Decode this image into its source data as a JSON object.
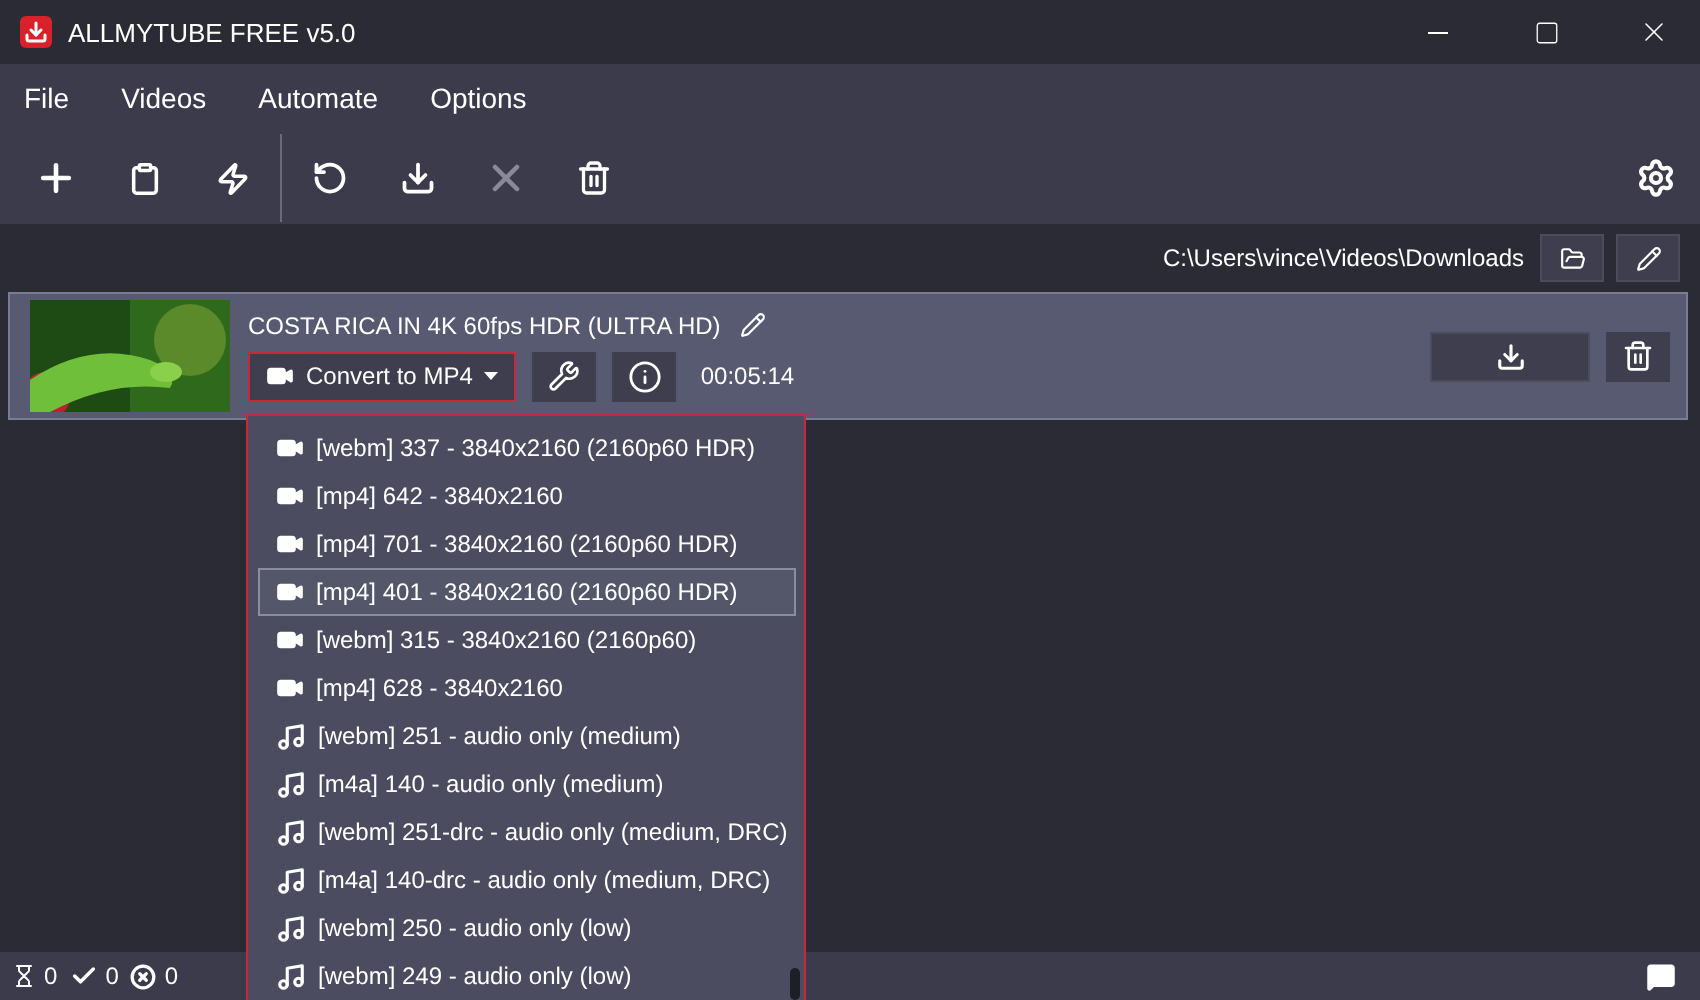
{
  "window": {
    "title": "ALLMYTUBE FREE v5.0"
  },
  "menu": [
    "File",
    "Videos",
    "Automate",
    "Options"
  ],
  "download_path": "C:\\Users\\vince\\Videos\\Downloads",
  "video": {
    "title": "COSTA RICA IN 4K 60fps HDR (ULTRA HD)",
    "format_button": "Convert to MP4",
    "duration": "00:05:14"
  },
  "format_menu": [
    {
      "kind": "video",
      "label": "[webm] 337 - 3840x2160 (2160p60 HDR)",
      "selected": false
    },
    {
      "kind": "video",
      "label": "[mp4] 642 - 3840x2160",
      "selected": false
    },
    {
      "kind": "video",
      "label": "[mp4] 701 - 3840x2160 (2160p60 HDR)",
      "selected": false
    },
    {
      "kind": "video",
      "label": "[mp4] 401 - 3840x2160 (2160p60 HDR)",
      "selected": true
    },
    {
      "kind": "video",
      "label": "[webm] 315 - 3840x2160 (2160p60)",
      "selected": false
    },
    {
      "kind": "video",
      "label": "[mp4] 628 - 3840x2160",
      "selected": false
    },
    {
      "kind": "audio",
      "label": "[webm] 251 - audio only (medium)",
      "selected": false
    },
    {
      "kind": "audio",
      "label": "[m4a] 140 - audio only (medium)",
      "selected": false
    },
    {
      "kind": "audio",
      "label": "[webm] 251-drc - audio only (medium, DRC)",
      "selected": false
    },
    {
      "kind": "audio",
      "label": "[m4a] 140-drc - audio only (medium, DRC)",
      "selected": false
    },
    {
      "kind": "audio",
      "label": "[webm] 250 - audio only (low)",
      "selected": false
    },
    {
      "kind": "audio",
      "label": "[webm] 249 - audio only (low)",
      "selected": false
    }
  ],
  "status_bar": {
    "waiting": "0",
    "done": "0",
    "failed": "0"
  }
}
